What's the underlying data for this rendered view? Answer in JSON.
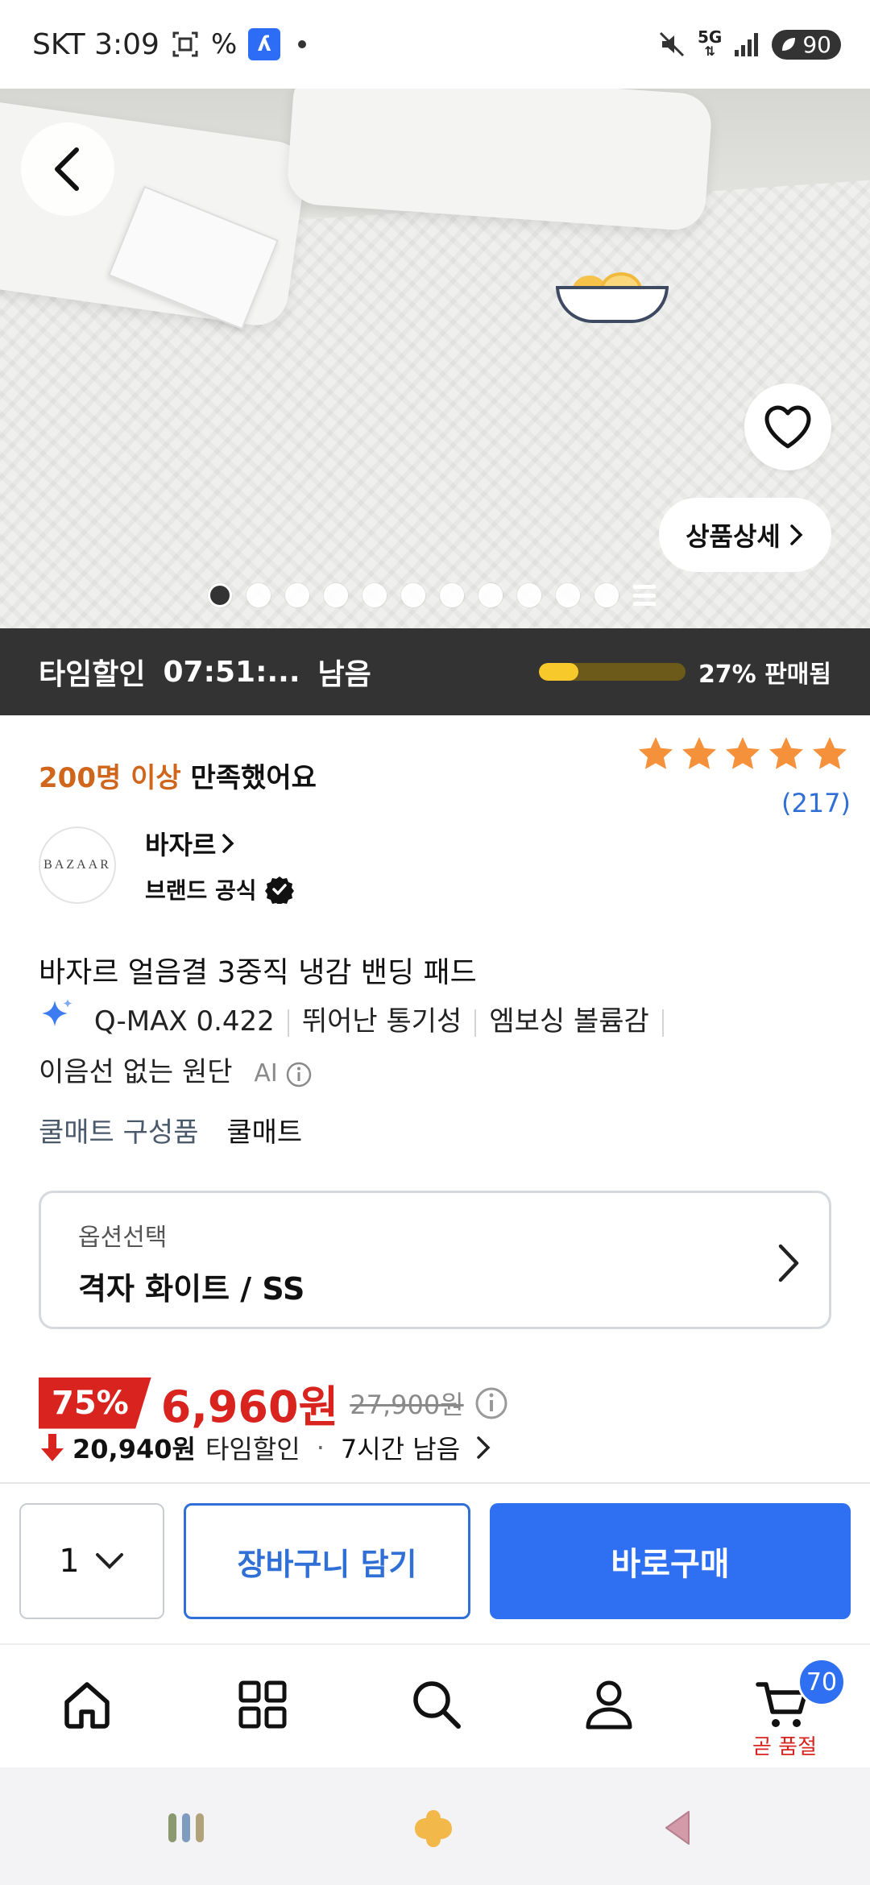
{
  "status_bar": {
    "carrier_time": "SKT 3:09",
    "network": "5G",
    "battery": "90",
    "app_badge_letter": "ʎ"
  },
  "hero": {
    "detail_button_label": "상품상세",
    "pager_dots": 11,
    "active_index": 0
  },
  "time_sale": {
    "label": "타임할인",
    "countdown": "07:51:...",
    "remaining": "남음",
    "sold_percent": 27,
    "sold_label": "27% 판매됨"
  },
  "rating": {
    "satisfaction_highlight": "200명 이상",
    "satisfaction_text": "만족했어요",
    "stars": 5,
    "review_count": "(217)"
  },
  "brand": {
    "logo_text": "BAZAAR",
    "name": "바자르",
    "official_label": "브랜드 공식"
  },
  "product": {
    "title": "바자르 얼음결 3중직 냉감 밴딩 패드",
    "features": [
      "Q-MAX 0.422",
      "뛰어난 통기성",
      "엠보싱 볼륨감",
      "이음선 없는 원단"
    ],
    "ai_label": "AI",
    "composition_label": "쿨매트 구성품",
    "composition_value": "쿨매트"
  },
  "option": {
    "label": "옵션선택",
    "value": "격자 화이트 / SS"
  },
  "price": {
    "discount": "75%",
    "sale_price": "6,960원",
    "original_price": "27,900원",
    "coupon_amount": "20,940원",
    "coupon_label": "타임할인",
    "separator": "·",
    "coupon_remaining": "7시간 남음"
  },
  "actions": {
    "quantity": "1",
    "cart_button": "장바구니 담기",
    "buy_button": "바로구매"
  },
  "bottom_nav": {
    "items": [
      "home-icon",
      "category-icon",
      "search-icon",
      "profile-icon",
      "cart-icon"
    ],
    "cart_count": "70",
    "cart_soon_label": "곧 품절"
  },
  "colors": {
    "accent_blue": "#2f6ff2",
    "sale_red": "#d8231f",
    "star_orange": "#f5913b",
    "highlight_orange": "#d0661b"
  }
}
